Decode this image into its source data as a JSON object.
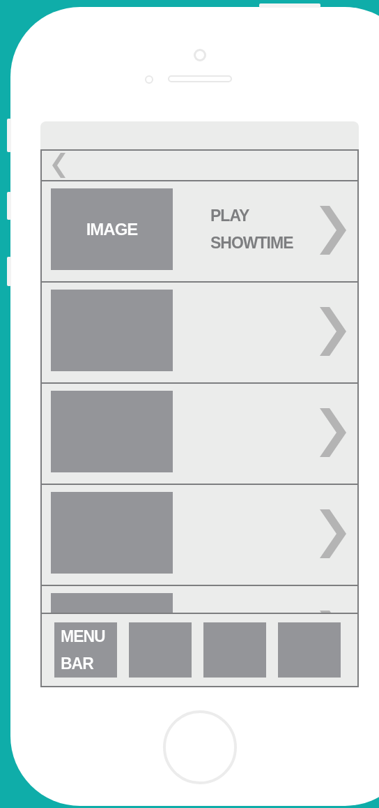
{
  "rows": [
    {
      "kind": "content",
      "image_label": "IMAGE",
      "title": "PLAY SHOWTIME"
    },
    {
      "kind": "blank"
    },
    {
      "kind": "blank"
    },
    {
      "kind": "blank"
    },
    {
      "kind": "blank"
    }
  ],
  "menu_bar": {
    "items": [
      {
        "kind": "labeled",
        "label": "MENU BAR"
      },
      {
        "kind": "blank"
      },
      {
        "kind": "blank"
      },
      {
        "kind": "blank"
      }
    ]
  }
}
